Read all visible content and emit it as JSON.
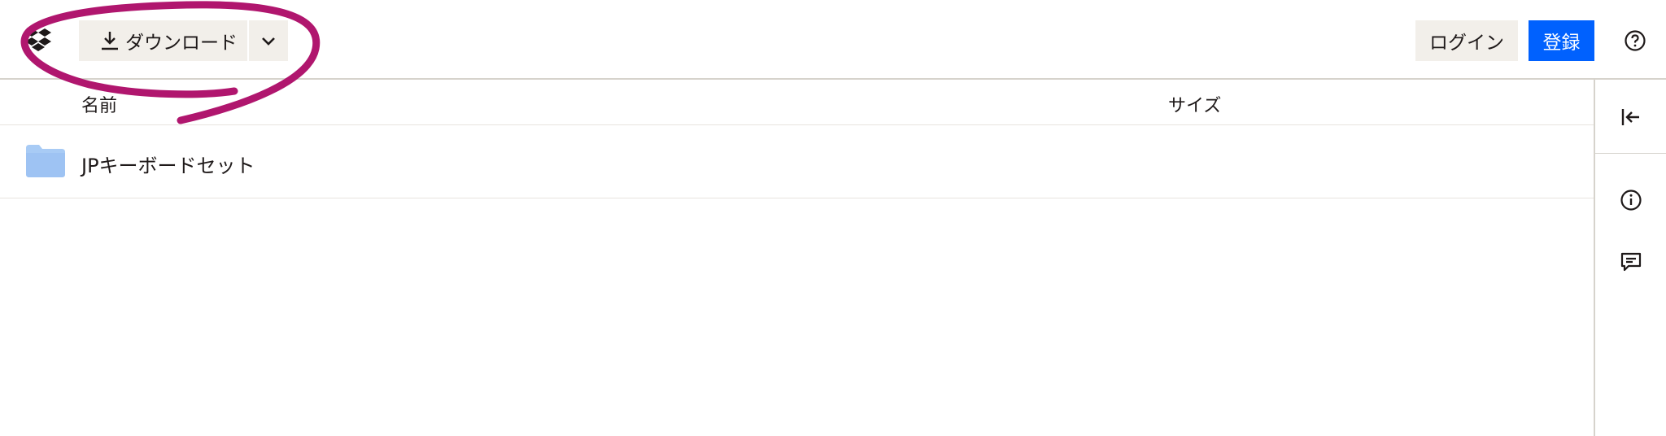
{
  "header": {
    "download_label": "ダウンロード",
    "login_label": "ログイン",
    "signup_label": "登録"
  },
  "list": {
    "columns": {
      "name": "名前",
      "size": "サイズ"
    },
    "rows": [
      {
        "name": "JPキーボードセット",
        "size": "",
        "icon": "folder-icon"
      }
    ]
  },
  "icons": {
    "logo": "dropbox-logo",
    "download": "download-icon",
    "caret": "chevron-down-icon",
    "help": "help-icon",
    "collapse": "collapse-left-icon",
    "info": "info-icon",
    "comment": "comment-icon"
  },
  "colors": {
    "primary": "#0061fe",
    "secondary_bg": "#f2efea",
    "annotation": "#b0166e",
    "folder": "#a8cbf5"
  }
}
